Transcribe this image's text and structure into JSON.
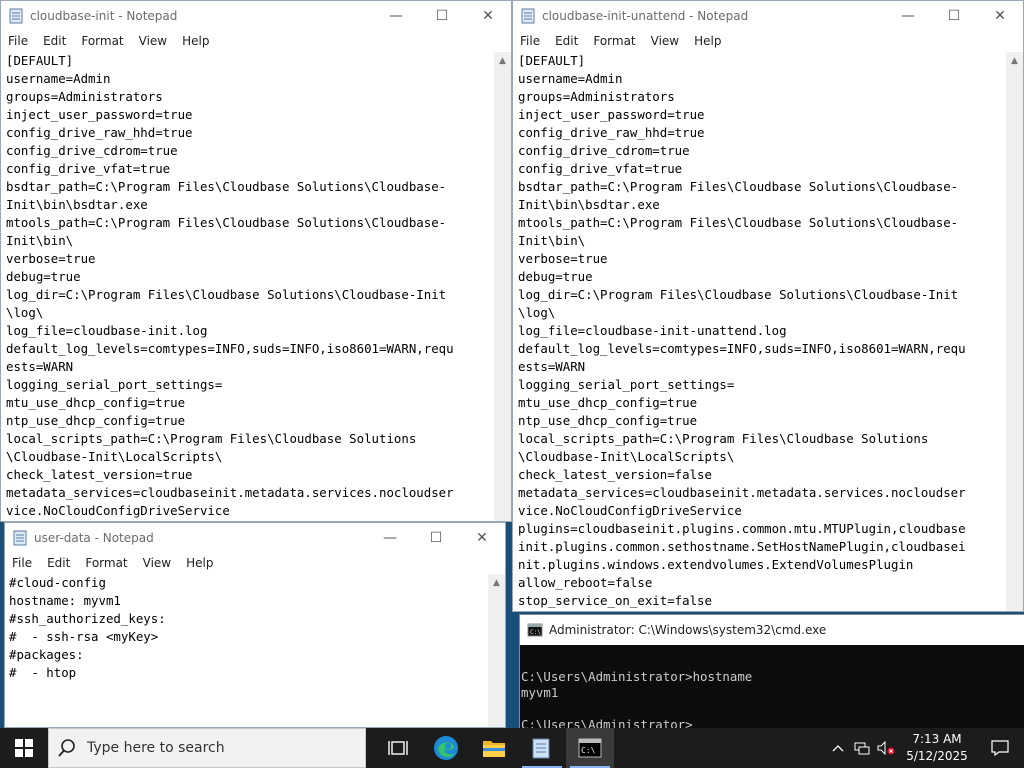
{
  "menu": [
    "File",
    "Edit",
    "Format",
    "View",
    "Help"
  ],
  "win1": {
    "title": "cloudbase-init - Notepad",
    "lines": [
      "[DEFAULT]",
      "username=Admin",
      "groups=Administrators",
      "inject_user_password=true",
      "config_drive_raw_hhd=true",
      "config_drive_cdrom=true",
      "config_drive_vfat=true",
      "bsdtar_path=C:\\Program Files\\Cloudbase Solutions\\Cloudbase-",
      "Init\\bin\\bsdtar.exe",
      "mtools_path=C:\\Program Files\\Cloudbase Solutions\\Cloudbase-",
      "Init\\bin\\",
      "verbose=true",
      "debug=true",
      "log_dir=C:\\Program Files\\Cloudbase Solutions\\Cloudbase-Init",
      "\\log\\",
      "log_file=cloudbase-init.log",
      "default_log_levels=comtypes=INFO,suds=INFO,iso8601=WARN,requ",
      "ests=WARN",
      "logging_serial_port_settings=",
      "mtu_use_dhcp_config=true",
      "ntp_use_dhcp_config=true",
      "local_scripts_path=C:\\Program Files\\Cloudbase Solutions",
      "\\Cloudbase-Init\\LocalScripts\\",
      "check_latest_version=true",
      "metadata_services=cloudbaseinit.metadata.services.nocloudser",
      "vice.NoCloudConfigDriveService"
    ]
  },
  "win2": {
    "title": "cloudbase-init-unattend - Notepad",
    "lines": [
      "[DEFAULT]",
      "username=Admin",
      "groups=Administrators",
      "inject_user_password=true",
      "config_drive_raw_hhd=true",
      "config_drive_cdrom=true",
      "config_drive_vfat=true",
      "bsdtar_path=C:\\Program Files\\Cloudbase Solutions\\Cloudbase-",
      "Init\\bin\\bsdtar.exe",
      "mtools_path=C:\\Program Files\\Cloudbase Solutions\\Cloudbase-",
      "Init\\bin\\",
      "verbose=true",
      "debug=true",
      "log_dir=C:\\Program Files\\Cloudbase Solutions\\Cloudbase-Init",
      "\\log\\",
      "log_file=cloudbase-init-unattend.log",
      "default_log_levels=comtypes=INFO,suds=INFO,iso8601=WARN,requ",
      "ests=WARN",
      "logging_serial_port_settings=",
      "mtu_use_dhcp_config=true",
      "ntp_use_dhcp_config=true",
      "local_scripts_path=C:\\Program Files\\Cloudbase Solutions",
      "\\Cloudbase-Init\\LocalScripts\\",
      "check_latest_version=false",
      "metadata_services=cloudbaseinit.metadata.services.nocloudser",
      "vice.NoCloudConfigDriveService",
      "plugins=cloudbaseinit.plugins.common.mtu.MTUPlugin,cloudbase",
      "init.plugins.common.sethostname.SetHostNamePlugin,cloudbasei",
      "nit.plugins.windows.extendvolumes.ExtendVolumesPlugin",
      "allow_reboot=false",
      "stop_service_on_exit=false"
    ]
  },
  "win3": {
    "title": "user-data - Notepad",
    "lines": [
      "#cloud-config",
      "hostname: myvm1",
      "#ssh_authorized_keys:",
      "#  - ssh-rsa <myKey>",
      "#packages:",
      "#  - htop"
    ]
  },
  "cmd": {
    "title": "Administrator: C:\\Windows\\system32\\cmd.exe",
    "lines": [
      "",
      "C:\\Users\\Administrator>hostname",
      "myvm1",
      "",
      "C:\\Users\\Administrator>"
    ]
  },
  "taskbar": {
    "search_placeholder": "Type here to search",
    "time": "7:13 AM",
    "date": "5/12/2025",
    "icons": [
      "windows-start-icon",
      "search-icon",
      "task-view-icon",
      "edge-icon",
      "file-explorer-icon",
      "notepad-icon",
      "cmd-icon"
    ]
  }
}
